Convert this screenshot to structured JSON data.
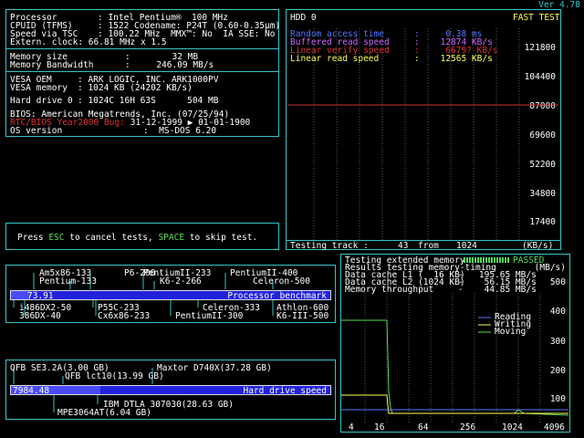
{
  "app": {
    "version": "Ver 4.78"
  },
  "info": {
    "processor_label": "Processor",
    "processor_value": ": Intel Pentium®  100 MHz",
    "cpuid_label": "CPUID (TFMS)",
    "cpuid_value": ": 1522 Codename: P24T (0.60-0.35µm)",
    "tsc_label": "Speed via TSC",
    "tsc_value": ": 100.22 MHz  MMX™: No  IA SSE: No",
    "extclock_line": "Extern. clock: 66.81 MHz x 1.5",
    "memsize_label": "Memory size",
    "memsize_value": ":        32 MB",
    "membw_label": "Memory Bandwidth",
    "membw_value": ":     246.09 MB/s",
    "vesa_oem_label": "VESA OEM",
    "vesa_oem_value": ": ARK LOGIC, INC. ARK1000PV",
    "vesa_mem_label": "VESA memory",
    "vesa_mem_value": ": 1024 KB (24202 KB/s)",
    "hdd_label": "Hard drive 0",
    "hdd_value": ": 1024C 16H 63S      504 MB",
    "bios_line": "BIOS: American Megatrends, Inc. (07/25/94)",
    "y2k_label": "RTC/BIOS Year2000 Bug:",
    "y2k_value": " 31-12-1999 ▶ 01-01-1900",
    "os_label": "OS version",
    "os_value": ":  MS-DOS 6.20"
  },
  "message": {
    "p1": "Press ",
    "esc": "ESC",
    "p2": " to cancel tests, ",
    "space": "SPACE",
    "p3": " to skip test."
  },
  "hdd_panel": {
    "title": "HDD 0",
    "mode": "FAST TEST",
    "random_label": "Random access time",
    "random_value": ":     0.38 ms",
    "buffered_label": "Buffered read speed",
    "buffered_value": ":    12874 KB/s",
    "verify_label": "Linear verify speed",
    "verify_value": ":     6679? KB/s",
    "linear_label": "Linear read speed",
    "linear_value": ":    12565 KB/s",
    "y_ticks": [
      "121800",
      "104400",
      "87000",
      "69600",
      "52200",
      "34800",
      "17400"
    ],
    "track_label": "Testing track :",
    "track_value": "43",
    "track_from": "from",
    "track_total": "1024",
    "track_unit": "(KB/s)"
  },
  "mem_panel": {
    "status_label": "Testing extended memory...",
    "status_value": "PASSED",
    "results_line": "Results testing memory-timing",
    "unit": "(MB/s)",
    "l1_label": "Data cache L1 (  16 KB)",
    "l1_value": "-   195.65 MB/s",
    "l2_label": "Data cache L2 (1024 KB)",
    "l2_value": "-    56.15 MB/s",
    "tp_label": "Memory throughput",
    "tp_value": "-    44.85 MB/s",
    "y_ticks": [
      "500",
      "400",
      "300",
      "200",
      "100"
    ],
    "x_ticks": [
      "4",
      "16",
      "64",
      "256",
      "1024",
      "4096"
    ],
    "legend": [
      "Reading",
      "Writing",
      "Moving"
    ]
  },
  "cpu_bench": {
    "value": "73.91",
    "label": "Processor benchmark",
    "fill_fraction": 0.06,
    "top_labels": [
      "Am5x86-133",
      "P6-200",
      "PentiumII-233",
      "PentiumII-400",
      "Pentium-133",
      "K6-2-266",
      "Celeron-500"
    ],
    "bottom_labels": [
      "i486DX2-50",
      "P55C-233",
      "Celeron-333",
      "Athlon-600",
      "386DX-40",
      "Cx6x86-233",
      "PentiumII-300",
      "K6-III-500"
    ]
  },
  "hd_bench": {
    "value": "7984.48",
    "label": "Hard drive speed",
    "fill_fraction": 0.28,
    "top_labels": [
      "QFB SE3.2A(3.00 GB)",
      "Maxtor D740X(37.28 GB)",
      "QFB lct10(13.99 GB)"
    ],
    "bottom_labels": [
      "IBM DTLA 307030(28.63 GB)",
      "MPE3064AT(6.04 GB)"
    ]
  },
  "colors": {
    "frame": "#33c6c6",
    "hdd_line": "#cc3333",
    "reading": "#5577ff",
    "writing": "#ffff55",
    "moving": "#55dd55"
  }
}
